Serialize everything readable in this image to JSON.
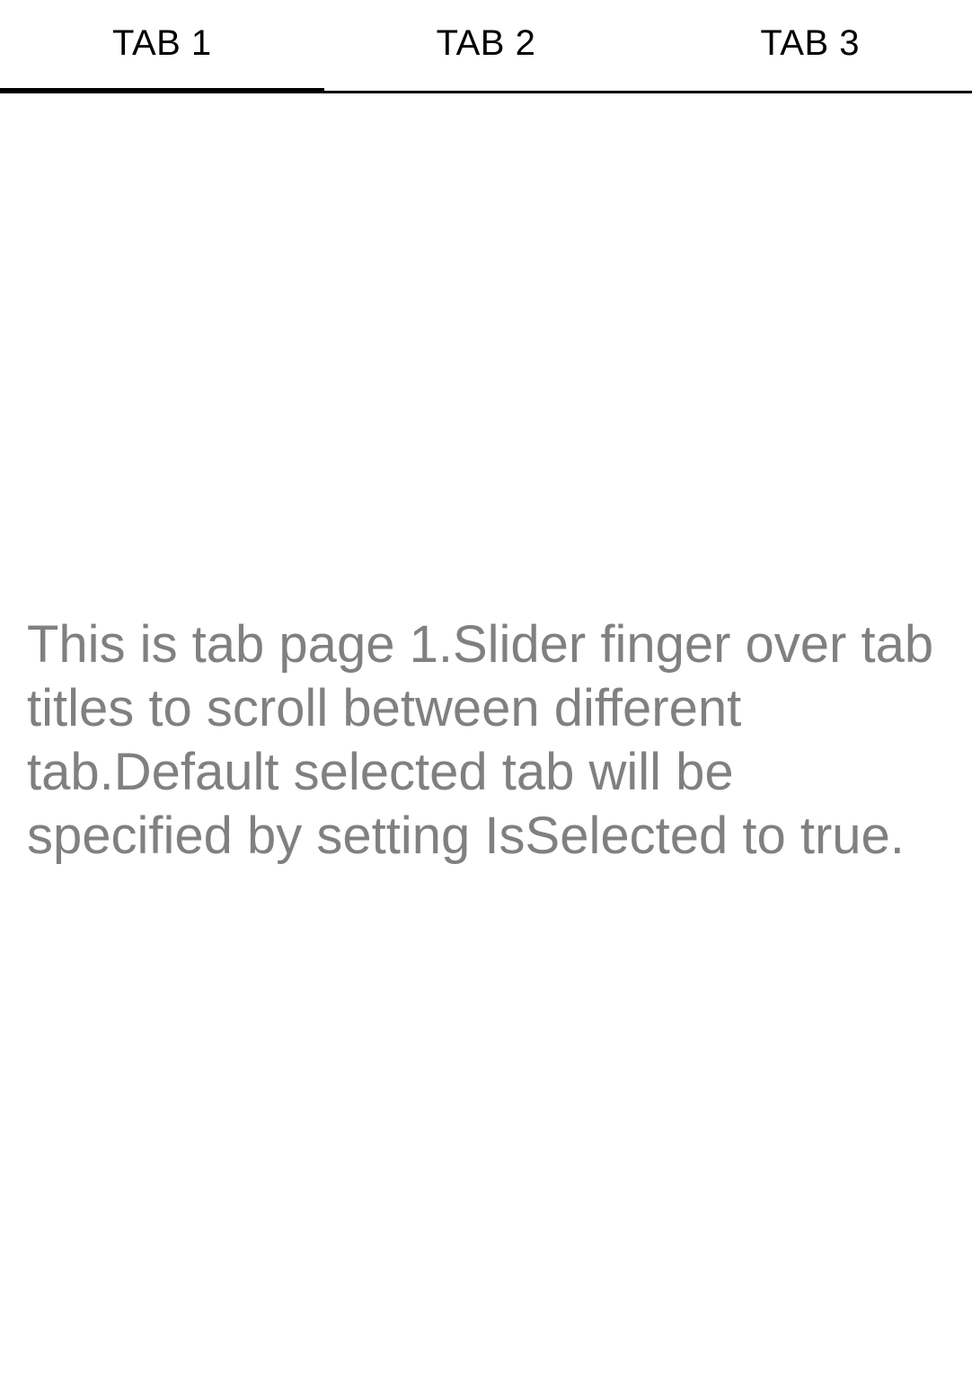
{
  "tabs": [
    {
      "label": "TAB 1",
      "selected": true
    },
    {
      "label": "TAB 2",
      "selected": false
    },
    {
      "label": "TAB 3",
      "selected": false
    }
  ],
  "content": {
    "text": "This is tab page 1.Slider finger over tab titles to scroll between different tab.Default selected tab will be specified by setting IsSelected to true."
  },
  "colors": {
    "tab_text": "#000000",
    "indicator": "#000000",
    "body_text": "#808080",
    "background": "#ffffff"
  }
}
